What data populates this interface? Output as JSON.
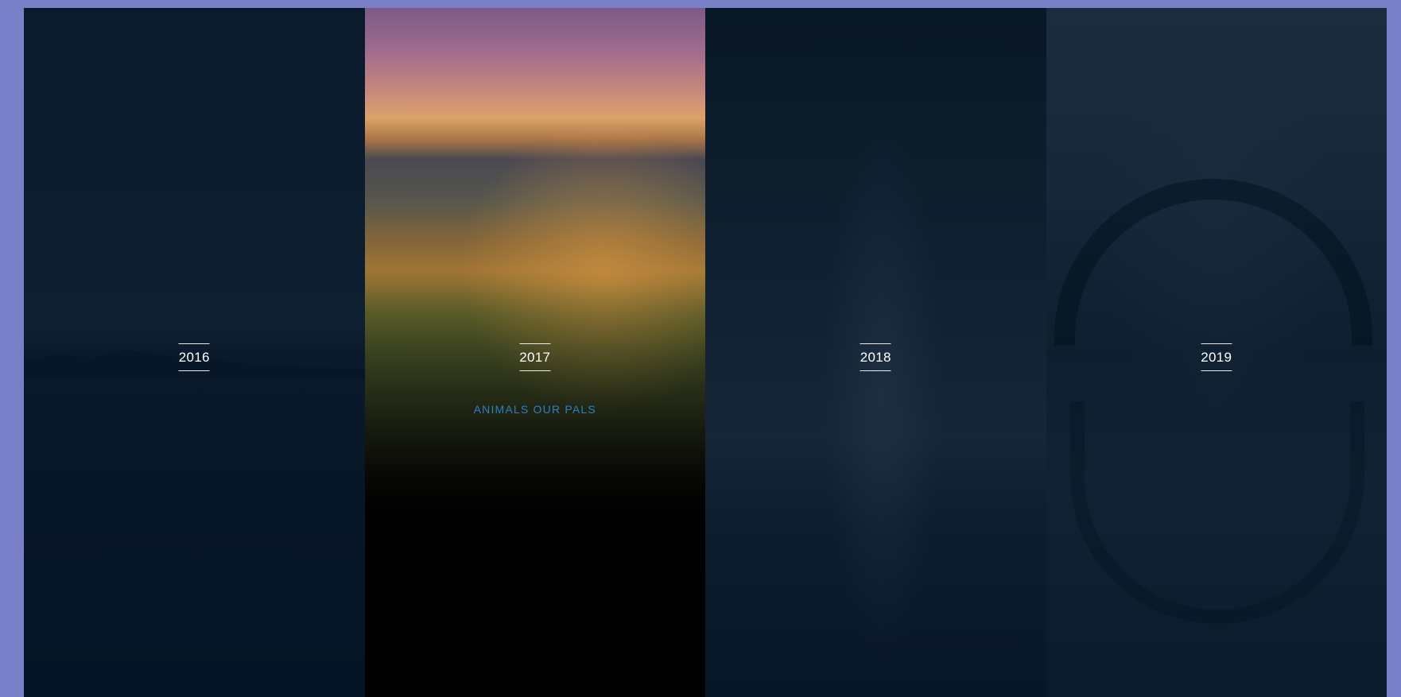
{
  "panels": [
    {
      "year": "2016",
      "subtitle": "",
      "active": false
    },
    {
      "year": "2017",
      "subtitle": "ANIMALS OUR PALS",
      "active": true
    },
    {
      "year": "2018",
      "subtitle": "",
      "active": false
    },
    {
      "year": "2019",
      "subtitle": "",
      "active": false
    }
  ],
  "colors": {
    "page_background": "#7a80c8",
    "subtitle_accent": "#2f7fc8",
    "inactive_overlay": "#021121"
  }
}
